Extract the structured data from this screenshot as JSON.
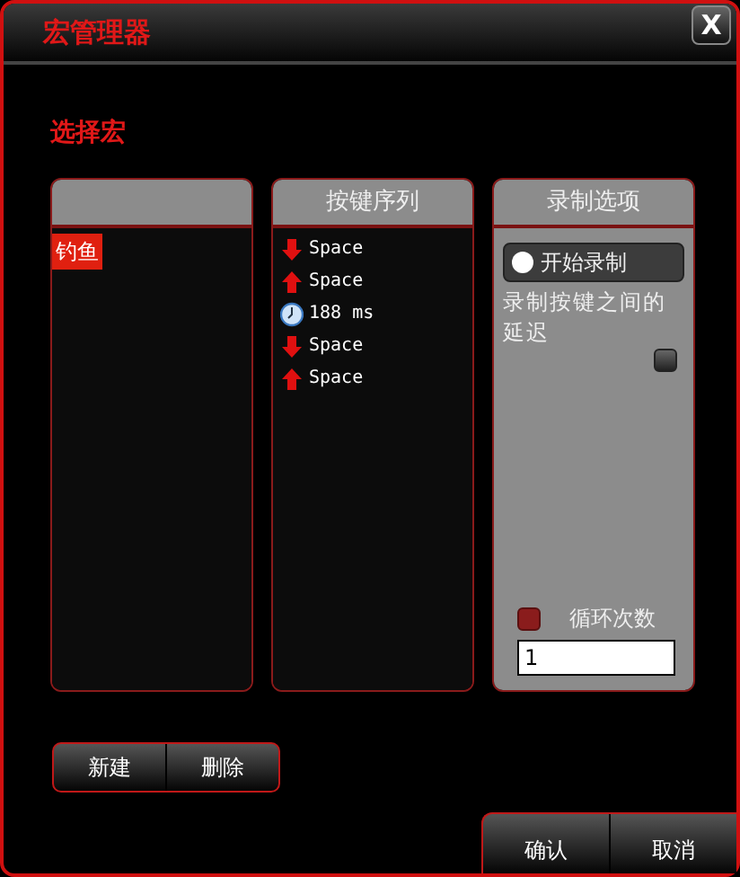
{
  "window": {
    "title": "宏管理器",
    "close": "X"
  },
  "section_title": "选择宏",
  "macro_list": {
    "items": [
      {
        "label": "钓鱼",
        "selected": true
      }
    ]
  },
  "sequence": {
    "header": "按键序列",
    "steps": [
      {
        "kind": "key_down",
        "label": "Space"
      },
      {
        "kind": "key_up",
        "label": "Space"
      },
      {
        "kind": "delay",
        "label": "188 ms"
      },
      {
        "kind": "key_down",
        "label": "Space"
      },
      {
        "kind": "key_up",
        "label": "Space"
      }
    ]
  },
  "options": {
    "header": "录制选项",
    "record_button": "开始录制",
    "delay_label": "录制按键之间的延迟",
    "delay_checked": false,
    "loop_label": "循环次数",
    "loop_checked": true,
    "loop_count": "1"
  },
  "buttons_left": [
    "新建",
    "删除"
  ],
  "buttons_right": [
    "确认",
    "取消"
  ]
}
